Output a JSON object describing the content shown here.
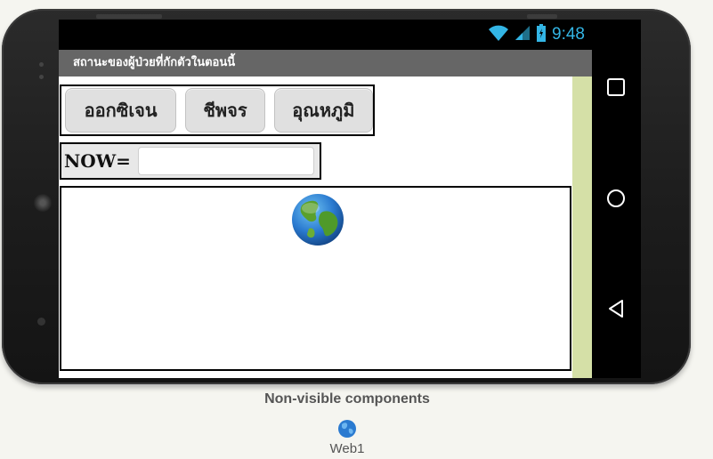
{
  "app": {
    "title": "สถานะของผู้ป่วยที่กักตัวในตอนนี้"
  },
  "status_bar": {
    "time": "9:48",
    "icons": [
      "wifi-icon",
      "cell-signal-icon",
      "battery-icon"
    ],
    "clock_color": "#33b5e5"
  },
  "buttons": [
    {
      "label": "ออกซิเจน"
    },
    {
      "label": "ชีพจร"
    },
    {
      "label": "อุณหภูมิ"
    }
  ],
  "now_row": {
    "label": "NOW=",
    "input_value": ""
  },
  "web_viewer": {
    "icon": "globe-icon"
  },
  "nav_bar": {
    "icons": [
      "recents-square-icon",
      "home-circle-icon",
      "back-triangle-icon"
    ]
  },
  "non_visible": {
    "title": "Non-visible components",
    "components": [
      {
        "name": "Web1",
        "icon": "globe-icon"
      }
    ]
  },
  "colors": {
    "title_bar": "#666666",
    "scroll_strip": "#d5e0a7",
    "button_bg": "#e0e0e0"
  }
}
